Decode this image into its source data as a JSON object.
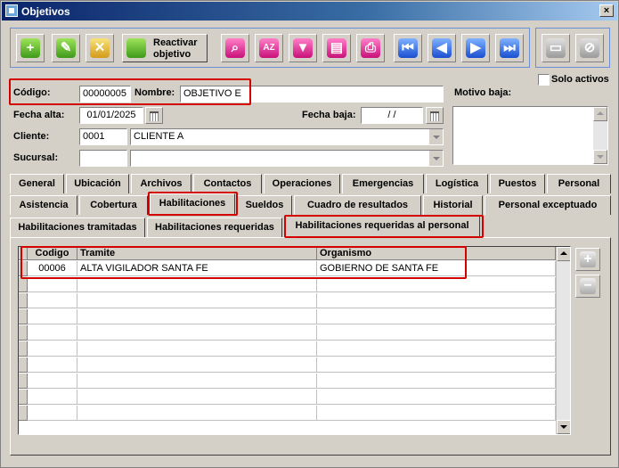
{
  "window": {
    "title": "Objetivos",
    "close_glyph": "×"
  },
  "toolbar": {
    "reactivar_line1": "Reactivar",
    "reactivar_line2": "objetivo"
  },
  "form": {
    "solo_activos_label": "Solo activos",
    "codigo_label": "Código:",
    "codigo_value": "00000005",
    "nombre_label": "Nombre:",
    "nombre_value": "OBJETIVO E",
    "motivo_baja_label": "Motivo baja:",
    "fecha_alta_label": "Fecha alta:",
    "fecha_alta_value": "01/01/2025",
    "fecha_baja_label": "Fecha baja:",
    "fecha_baja_value": "/  /",
    "cliente_label": "Cliente:",
    "cliente_code": "0001",
    "cliente_name": "CLIENTE A",
    "sucursal_label": "Sucursal:",
    "sucursal_code": "",
    "sucursal_name": ""
  },
  "tabs_row1": [
    "General",
    "Ubicación",
    "Archivos",
    "Contactos",
    "Operaciones",
    "Emergencias",
    "Logística",
    "Puestos",
    "Personal"
  ],
  "tabs_row2": [
    "Asistencia",
    "Cobertura",
    "Habilitaciones",
    "Sueldos",
    "Cuadro de resultados",
    "Historial",
    "Personal exceptuado"
  ],
  "subtabs": [
    "Habilitaciones tramitadas",
    "Habilitaciones requeridas",
    "Habilitaciones requeridas al personal"
  ],
  "grid": {
    "columns": [
      "Codigo",
      "Tramite",
      "Organismo"
    ],
    "rows": [
      [
        "00006",
        "ALTA VIGILADOR SANTA FE",
        "GOBIERNO DE SANTA FE"
      ]
    ]
  },
  "side_buttons": {
    "add_glyph": "+",
    "remove_glyph": "−"
  },
  "colors": {
    "highlight": "#d40000",
    "title_start": "#0a246a",
    "toolbar_border": "#6b8fd6"
  }
}
